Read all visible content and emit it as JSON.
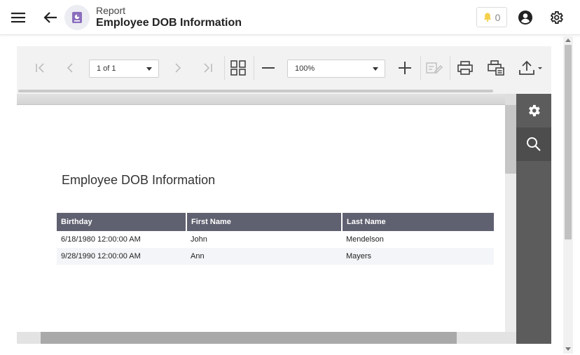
{
  "header": {
    "breadcrumb": "Report",
    "title": "Employee DOB Information",
    "notification_count": "0",
    "colors": {
      "avatar_bg": "#ececf3",
      "avatar_icon": "#8b6fbd",
      "bell": "#f5d04a"
    }
  },
  "toolbar": {
    "page_select": "1 of 1",
    "zoom_select": "100%"
  },
  "report": {
    "heading": "Employee DOB Information",
    "columns": [
      "Birthday",
      "First Name",
      "Last Name"
    ],
    "rows": [
      [
        "6/18/1980 12:00:00 AM",
        "John",
        "Mendelson"
      ],
      [
        "9/28/1990 12:00:00 AM",
        "Ann",
        "Mayers"
      ]
    ],
    "header_color": "#5f6070"
  },
  "icons": {
    "menu": "menu-icon",
    "back": "arrow-left-icon",
    "report": "report-icon",
    "bell": "bell-icon",
    "user": "user-circle-icon",
    "settings": "gear-icon",
    "first_page": "first-page-icon",
    "prev_page": "chevron-left-icon",
    "next_page": "chevron-right-icon",
    "last_page": "last-page-icon",
    "multipage": "multipage-icon",
    "zoom_out": "minus-icon",
    "zoom_in": "plus-icon",
    "edit": "edit-fields-icon",
    "print": "print-icon",
    "print_page": "print-page-icon",
    "export": "export-icon",
    "side_settings": "gear-icon",
    "side_search": "search-icon"
  }
}
